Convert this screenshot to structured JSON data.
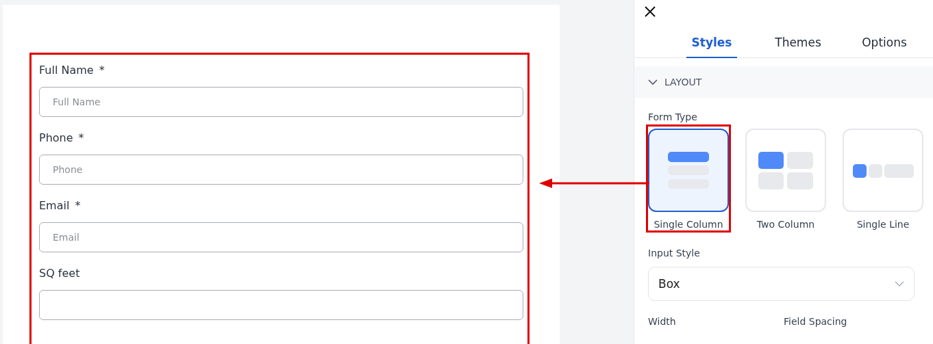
{
  "form": {
    "highlighted": true,
    "fields": [
      {
        "label": "Full Name",
        "required_mark": "*",
        "placeholder": "Full Name"
      },
      {
        "label": "Phone",
        "required_mark": "*",
        "placeholder": "Phone"
      },
      {
        "label": "Email",
        "required_mark": "*",
        "placeholder": "Email"
      },
      {
        "label": "SQ feet"
      }
    ]
  },
  "panel": {
    "tabs": [
      {
        "label": "Styles",
        "selected": true
      },
      {
        "label": "Themes",
        "selected": false
      },
      {
        "label": "Options",
        "selected": false
      }
    ],
    "section": {
      "title": "LAYOUT",
      "expanded": true
    },
    "form_type": {
      "label": "Form Type",
      "options": [
        {
          "label": "Single Column",
          "kind": "single",
          "selected": true,
          "highlighted": true
        },
        {
          "label": "Two Column",
          "kind": "two",
          "selected": false,
          "highlighted": false
        },
        {
          "label": "Single Line",
          "kind": "line",
          "selected": false,
          "highlighted": false
        }
      ]
    },
    "input_style": {
      "label": "Input Style",
      "value": "Box"
    },
    "bottom_labels": [
      "Width",
      "Field Spacing"
    ]
  }
}
